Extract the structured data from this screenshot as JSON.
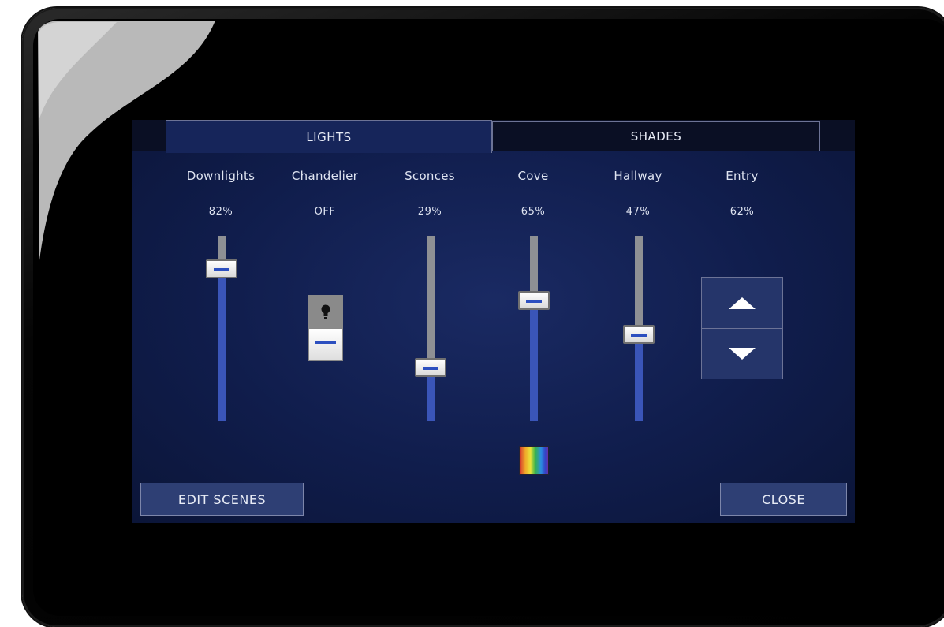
{
  "tabs": [
    {
      "label": "LIGHTS",
      "active": true
    },
    {
      "label": "SHADES",
      "active": false
    }
  ],
  "channels": [
    {
      "name": "Downlights",
      "value": "82%",
      "type": "slider",
      "level": 0.82
    },
    {
      "name": "Chandelier",
      "value": "OFF",
      "type": "switch",
      "state": "off"
    },
    {
      "name": "Sconces",
      "value": "29%",
      "type": "slider",
      "level": 0.29
    },
    {
      "name": "Cove",
      "value": "65%",
      "type": "slider",
      "level": 0.65
    },
    {
      "name": "Hallway",
      "value": "47%",
      "type": "slider",
      "level": 0.47
    },
    {
      "name": "Entry",
      "value": "62%",
      "type": "updown"
    }
  ],
  "icons": {
    "chandelier": "lightbulb-icon",
    "entry_up": "arrow-up-icon",
    "entry_down": "arrow-down-icon",
    "cove_color": "color-spectrum-icon"
  },
  "buttons": {
    "edit_scenes": "EDIT SCENES",
    "close": "CLOSE"
  },
  "colors": {
    "screen_bg": "#101d4c",
    "slider_fill": "#3a55b8",
    "slider_track": "#8e9094",
    "handle_mark": "#2c4fbf"
  }
}
